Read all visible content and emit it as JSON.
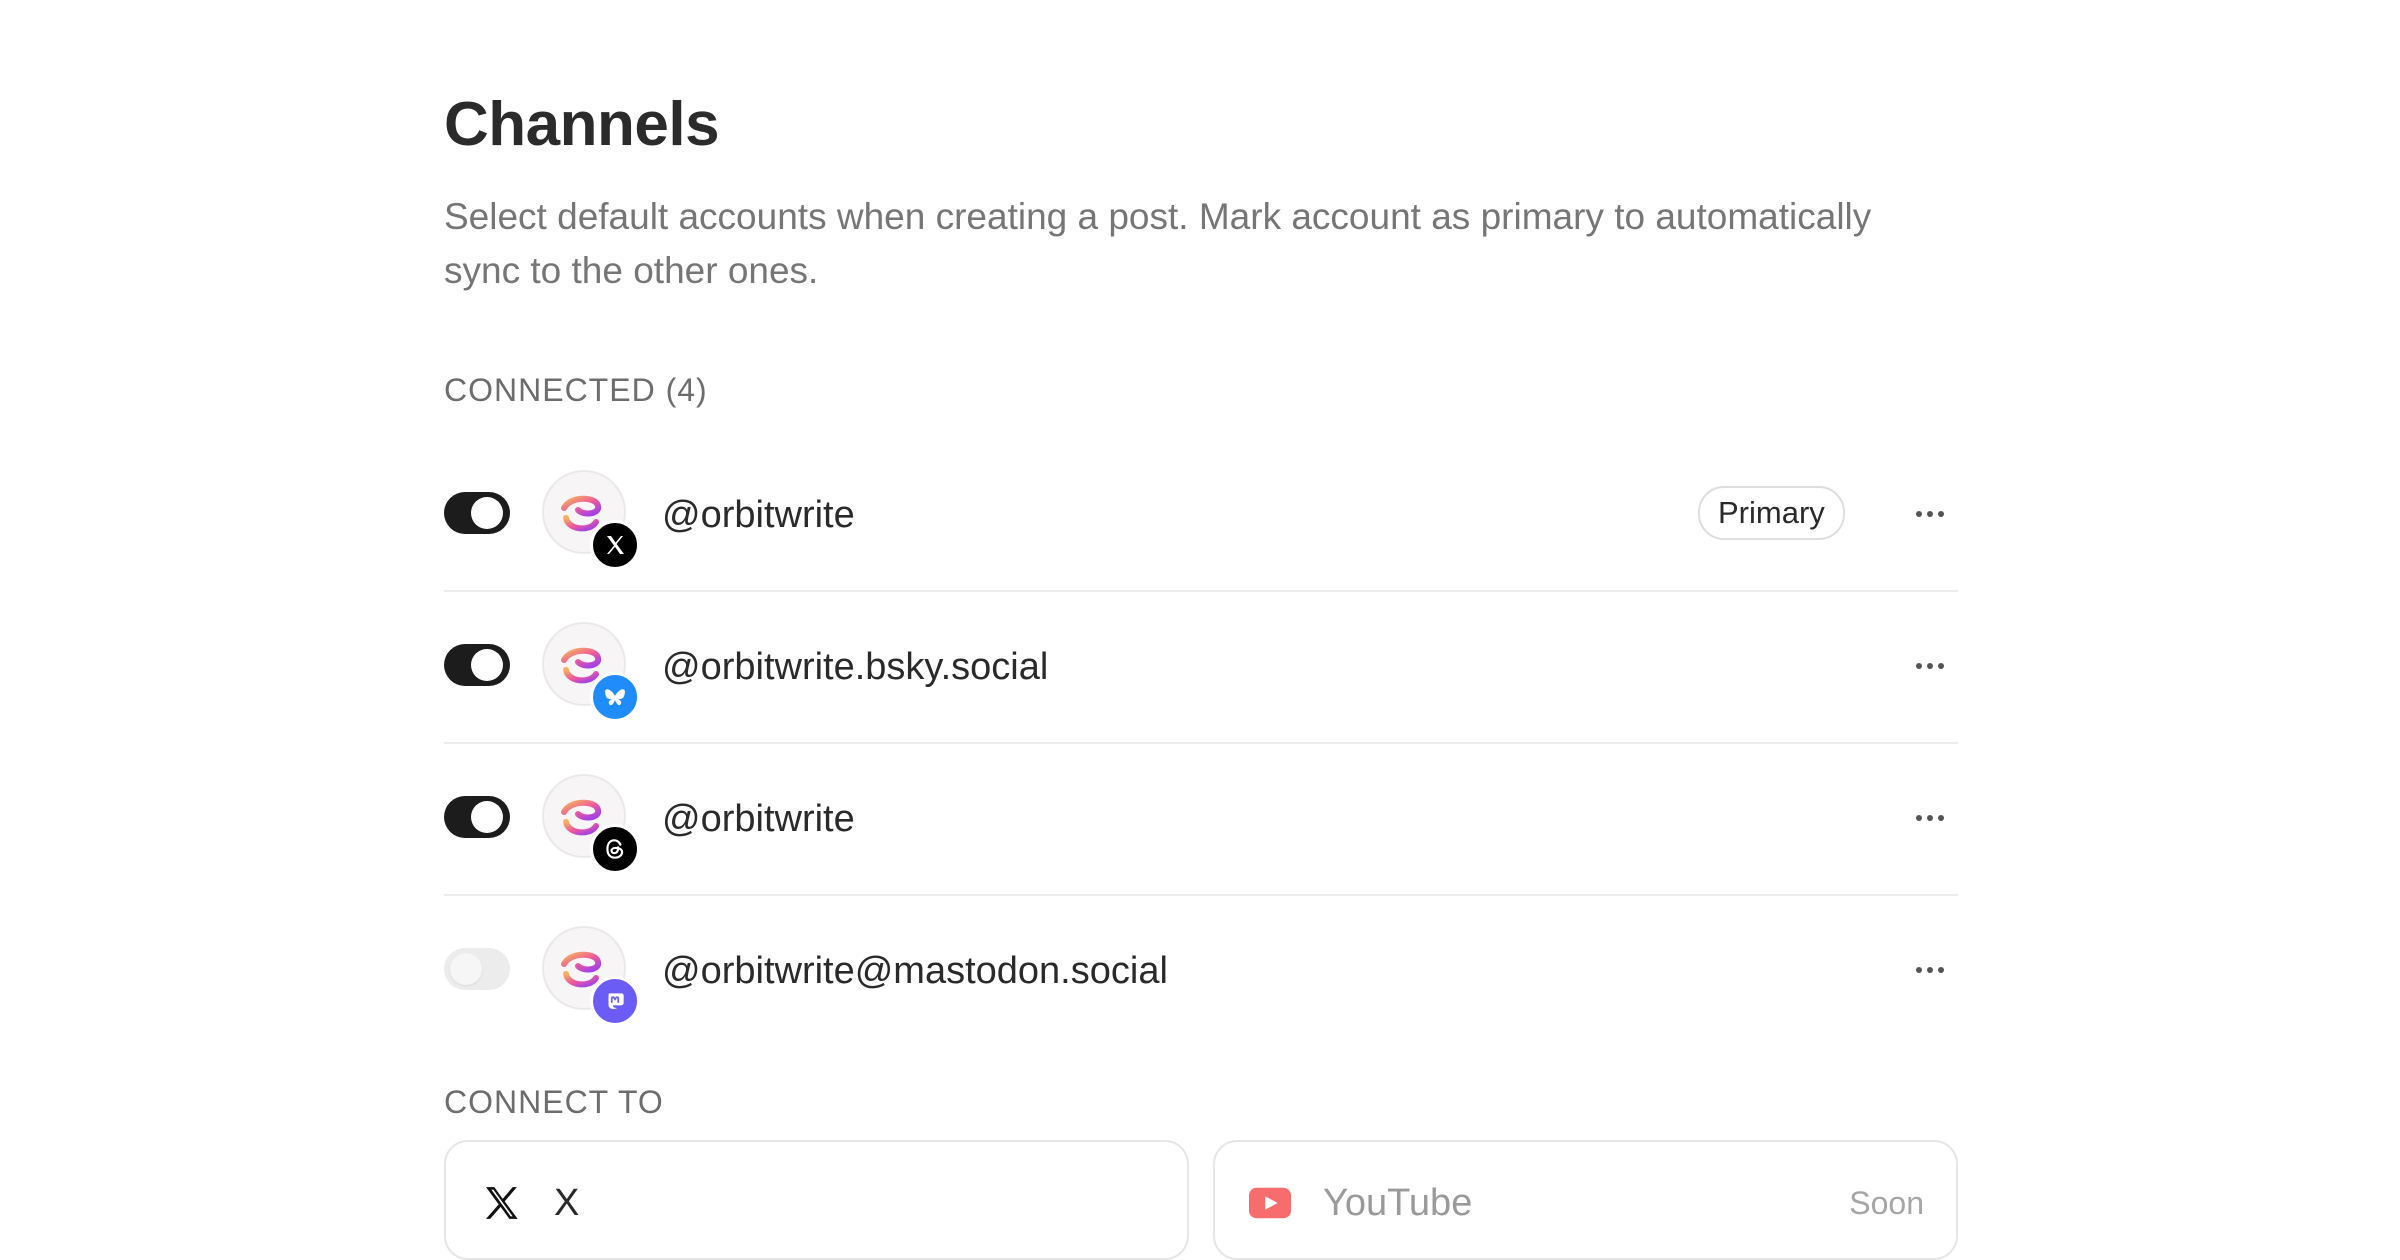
{
  "page": {
    "title": "Channels",
    "description": "Select default accounts when creating a post. Mark account as primary to automatically sync to the other ones."
  },
  "connected": {
    "label": "CONNECTED (4)",
    "accounts": [
      {
        "handle": "@orbitwrite",
        "platform": "x",
        "platform_icon": "x-logo-icon",
        "enabled": true,
        "primary_label": "Primary"
      },
      {
        "handle": "@orbitwrite.bsky.social",
        "platform": "bluesky",
        "platform_icon": "bluesky-butterfly-icon",
        "enabled": true
      },
      {
        "handle": "@orbitwrite",
        "platform": "threads",
        "platform_icon": "threads-logo-icon",
        "enabled": true
      },
      {
        "handle": "@orbitwrite@mastodon.social",
        "platform": "mastodon",
        "platform_icon": "mastodon-logo-icon",
        "enabled": false
      }
    ]
  },
  "connect_to": {
    "label": "CONNECT TO",
    "options": [
      {
        "label": "X",
        "icon": "x-logo-icon",
        "status": ""
      },
      {
        "label": "YouTube",
        "icon": "youtube-logo-icon",
        "status": "Soon"
      }
    ]
  },
  "colors": {
    "toggle_on": "#1c1c1c",
    "toggle_off": "#ececec",
    "bluesky": "#1f8cfa",
    "mastodon": "#6c5cf6",
    "x": "#000000",
    "threads": "#000000",
    "youtube": "#f76c6c"
  }
}
